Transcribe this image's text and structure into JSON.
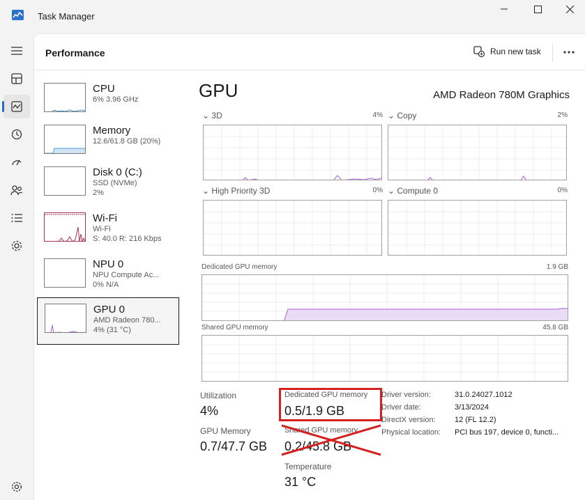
{
  "window": {
    "title": "Task Manager"
  },
  "header": {
    "title": "Performance",
    "run_new_task": "Run new task"
  },
  "rail": [
    {
      "icon": "hamburger-icon"
    },
    {
      "icon": "processes-icon"
    },
    {
      "icon": "performance-icon",
      "active": true
    },
    {
      "icon": "app-history-icon"
    },
    {
      "icon": "startup-apps-icon"
    },
    {
      "icon": "users-icon"
    },
    {
      "icon": "details-icon"
    },
    {
      "icon": "services-icon"
    },
    {
      "icon": "settings-icon"
    }
  ],
  "devices": [
    {
      "name": "CPU",
      "sub1": "6% 3.96 GHz",
      "sub2": ""
    },
    {
      "name": "Memory",
      "sub1": "12.6/61.8 GB (20%)",
      "sub2": ""
    },
    {
      "name": "Disk 0 (C:)",
      "sub1": "SSD (NVMe)",
      "sub2": "2%"
    },
    {
      "name": "Wi-Fi",
      "sub1": "Wi-Fi",
      "sub2": "S: 40.0  R: 216 Kbps"
    },
    {
      "name": "NPU 0",
      "sub1": "NPU Compute Ac...",
      "sub2": "0% N/A"
    },
    {
      "name": "GPU 0",
      "sub1": "AMD Radeon 780...",
      "sub2": "4% (31 °C)",
      "selected": true
    }
  ],
  "gpu": {
    "title": "GPU",
    "model": "AMD Radeon 780M Graphics",
    "engines": [
      {
        "name": "3D",
        "pct": "4%"
      },
      {
        "name": "Copy",
        "pct": "2%"
      },
      {
        "name": "High Priority 3D",
        "pct": "0%"
      },
      {
        "name": "Compute 0",
        "pct": "0%"
      }
    ],
    "dedicated": {
      "label": "Dedicated GPU memory",
      "max": "1.9 GB"
    },
    "shared": {
      "label": "Shared GPU memory",
      "max": "45.8 GB"
    },
    "stats": {
      "utilization_label": "Utilization",
      "utilization": "4%",
      "ded_label": "Dedicated GPU memory",
      "ded_value": "0.5/1.9 GB",
      "gpumem_label": "GPU Memory",
      "gpumem_value": "0.7/47.7 GB",
      "shared_label": "Shared GPU memory",
      "shared_value": "0.2/45.8 GB",
      "temp_label": "Temperature",
      "temp_value": "31 °C"
    },
    "info": [
      {
        "label": "Driver version:",
        "value": "31.0.24027.1012"
      },
      {
        "label": "Driver date:",
        "value": "3/13/2024"
      },
      {
        "label": "DirectX version:",
        "value": "12 (FL 12.2)"
      },
      {
        "label": "Physical location:",
        "value": "PCI bus 197, device 0, functi..."
      }
    ]
  },
  "colors": {
    "gpu_line": "#a75ddb",
    "gpu_fill": "#eadbf7",
    "memory_line": "#5a9fd8",
    "memory_fill": "#cfe3f5",
    "wifi_line": "#a8315b",
    "cpu_line": "#3d8fbf",
    "highlight": "#d42020",
    "accent": "#1f6fc5"
  }
}
